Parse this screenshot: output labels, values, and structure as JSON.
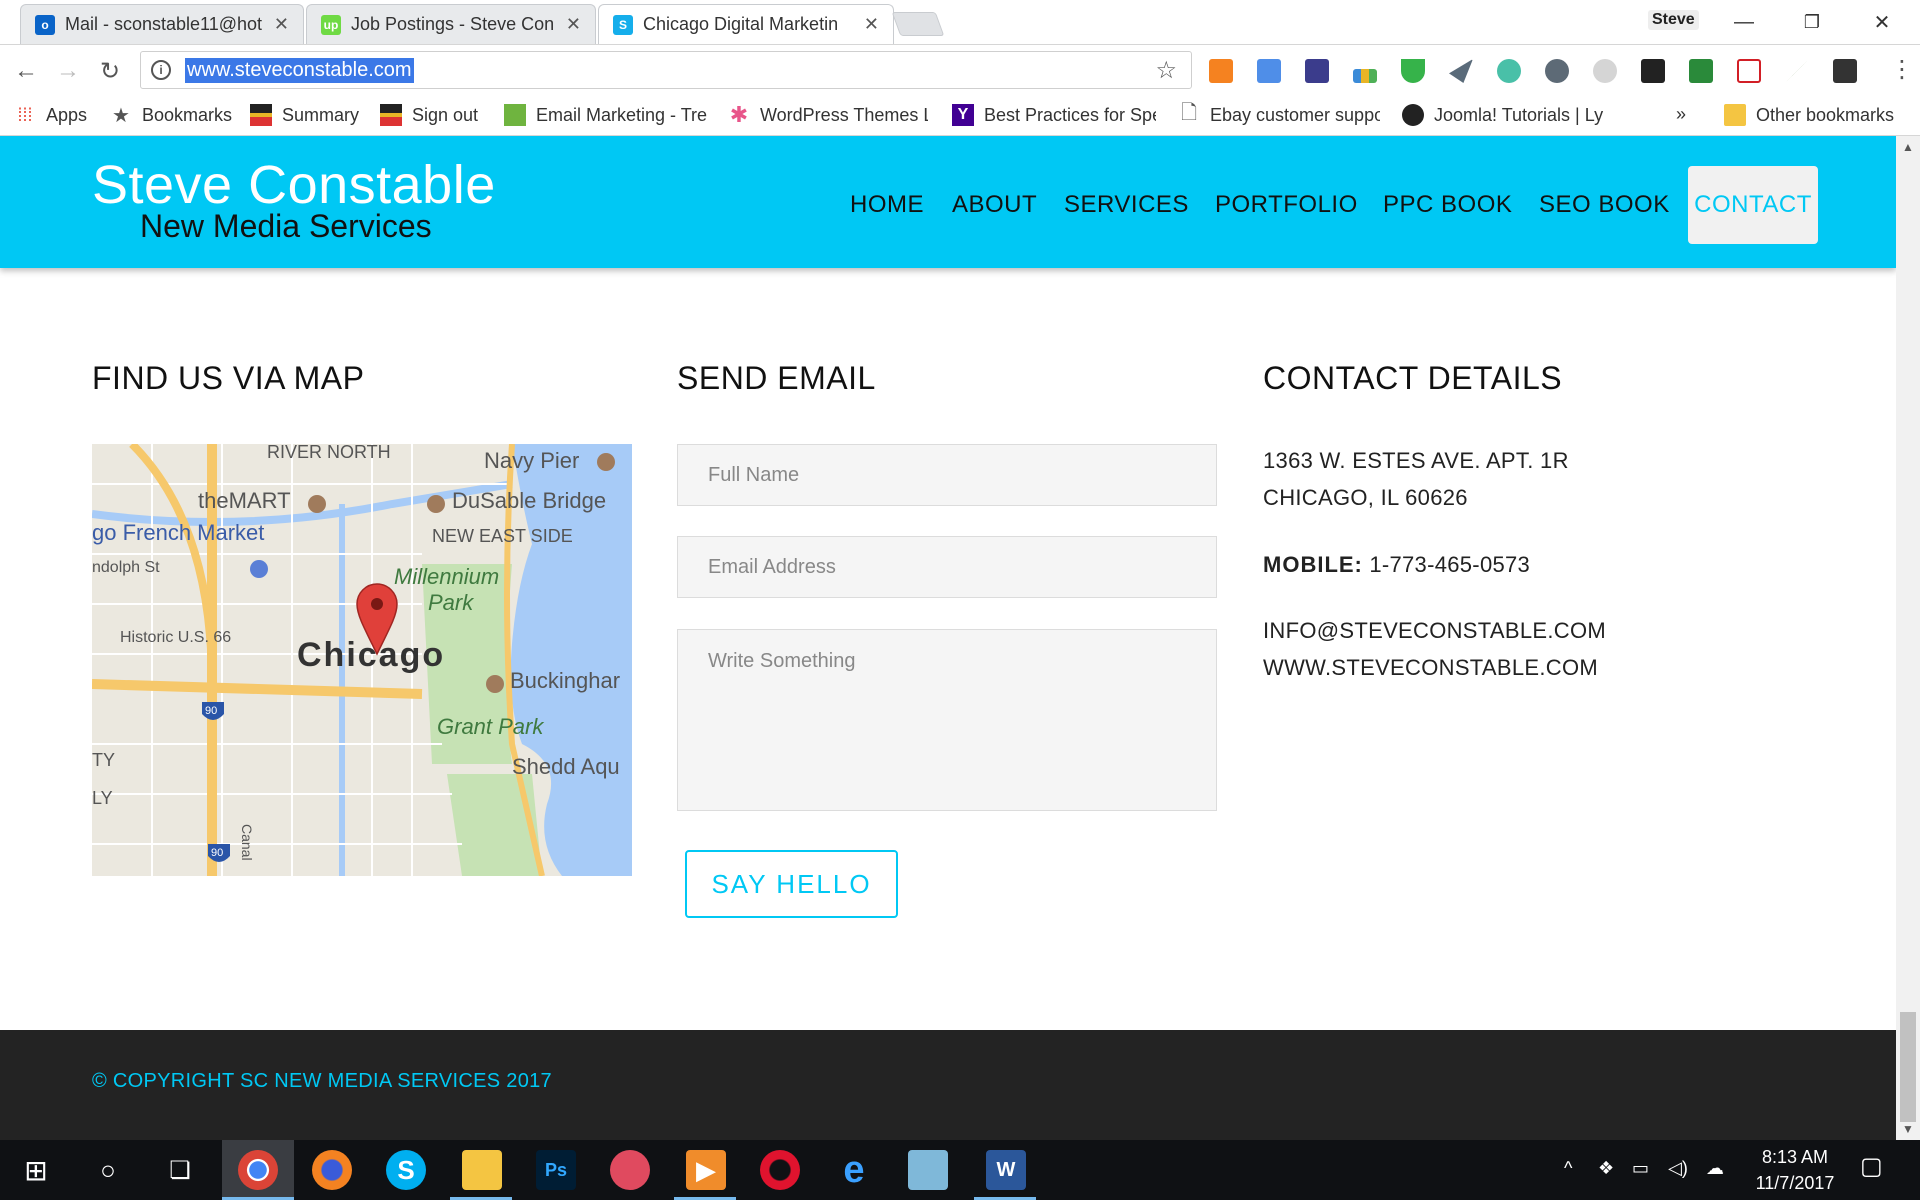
{
  "browser": {
    "tabs": [
      {
        "title": "Mail - sconstable11@hot",
        "icon": "outlook-icon",
        "active": false
      },
      {
        "title": "Job Postings - Steve Con",
        "icon": "upwork-icon",
        "active": false
      },
      {
        "title": "Chicago Digital Marketin",
        "icon": "site-s-icon",
        "active": true
      }
    ],
    "profile_name": "Steve",
    "address": "www.steveconstable.com",
    "bookmarks": [
      {
        "label": "Apps",
        "icon": "apps-grid-icon"
      },
      {
        "label": "Bookmarks",
        "icon": "star-icon"
      },
      {
        "label": "Summary",
        "icon": "summary-icon"
      },
      {
        "label": "Sign out",
        "icon": "signout-icon"
      },
      {
        "label": "Email Marketing - Tre",
        "icon": "email-marketing-icon"
      },
      {
        "label": "WordPress Themes L",
        "icon": "wordpress-themes-icon"
      },
      {
        "label": "Best Practices for Spe",
        "icon": "yahoo-icon"
      },
      {
        "label": "Ebay customer suppo",
        "icon": "page-icon"
      },
      {
        "label": "Joomla! Tutorials | Ly",
        "icon": "joomla-icon"
      }
    ],
    "bookmarks_overflow": "»",
    "other_bookmarks": "Other bookmarks"
  },
  "site": {
    "logo_title": "Steve Constable",
    "logo_subtitle": "New Media Services",
    "nav": [
      "HOME",
      "ABOUT",
      "SERVICES",
      "PORTFOLIO",
      "PPC BOOK",
      "SEO BOOK",
      "CONTACT"
    ],
    "active_nav": "CONTACT",
    "map_section": {
      "title": "FIND US VIA MAP",
      "labels": [
        "RIVER NORTH",
        "Navy Pier",
        "theMART",
        "DuSable Bridge",
        "NEW EAST SIDE",
        "go French Market",
        "ndolph St",
        "Millennium",
        "Park",
        "Historic U.S. 66",
        "Chicago",
        "Buckinghar",
        "Grant Park",
        "Shedd Aqu",
        "TY",
        "LY",
        "Canal",
        "90",
        "90"
      ]
    },
    "email_section": {
      "title": "SEND EMAIL",
      "name_placeholder": "Full Name",
      "email_placeholder": "Email Address",
      "message_placeholder": "Write Something",
      "submit_label": "SAY HELLO"
    },
    "contact_section": {
      "title": "CONTACT DETAILS",
      "address_line1": "1363 W. ESTES AVE. APT. 1R",
      "address_line2": "CHICAGO, IL 60626",
      "mobile_label": "MOBILE:",
      "mobile_value": "1-773-465-0573",
      "email": "INFO@STEVECONSTABLE.COM",
      "website": "WWW.STEVECONSTABLE.COM"
    },
    "footer_copyright": "© COPYRIGHT SC NEW MEDIA SERVICES 2017"
  },
  "taskbar": {
    "time": "8:13 AM",
    "date": "11/7/2017"
  },
  "colors": {
    "brand_cyan": "#00c8f4",
    "footer_bg": "#232323",
    "taskbar_bg": "#0f1114"
  }
}
